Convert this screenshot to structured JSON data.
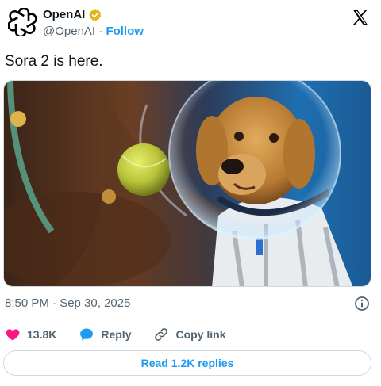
{
  "author": {
    "display_name": "OpenAI",
    "handle": "@OpenAI",
    "separator": " · ",
    "follow_label": "Follow",
    "avatar_icon": "openai-logo-icon",
    "verified_icon": "verified-gold-badge-icon",
    "verified_color": "#e2b719"
  },
  "platform_logo": "x-logo-icon",
  "tweet": {
    "text": "Sora 2 is here.",
    "media_icon": "video-still-dog-astronaut",
    "timestamp": "8:50 PM · Sep 30, 2025",
    "info_icon": "info-icon"
  },
  "actions": {
    "like": {
      "icon": "heart-icon",
      "label": "13.8K",
      "color": "#f91880"
    },
    "reply": {
      "icon": "speech-bubble-icon",
      "label": "Reply",
      "color": "#1d9bf0"
    },
    "copy": {
      "icon": "link-icon",
      "label": "Copy link"
    }
  },
  "replies_button": {
    "label": "Read 1.2K replies"
  },
  "colors": {
    "accent": "#1d9bf0",
    "secondary_text": "#536471",
    "primary_text": "#0f1419",
    "border": "#cfd9de"
  }
}
